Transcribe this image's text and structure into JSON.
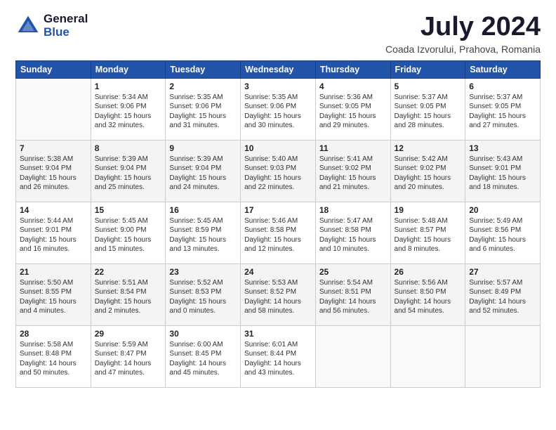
{
  "header": {
    "logo_general": "General",
    "logo_blue": "Blue",
    "title": "July 2024",
    "location": "Coada Izvorului, Prahova, Romania"
  },
  "weekdays": [
    "Sunday",
    "Monday",
    "Tuesday",
    "Wednesday",
    "Thursday",
    "Friday",
    "Saturday"
  ],
  "weeks": [
    [
      {
        "num": "",
        "info": ""
      },
      {
        "num": "1",
        "info": "Sunrise: 5:34 AM\nSunset: 9:06 PM\nDaylight: 15 hours\nand 32 minutes."
      },
      {
        "num": "2",
        "info": "Sunrise: 5:35 AM\nSunset: 9:06 PM\nDaylight: 15 hours\nand 31 minutes."
      },
      {
        "num": "3",
        "info": "Sunrise: 5:35 AM\nSunset: 9:06 PM\nDaylight: 15 hours\nand 30 minutes."
      },
      {
        "num": "4",
        "info": "Sunrise: 5:36 AM\nSunset: 9:05 PM\nDaylight: 15 hours\nand 29 minutes."
      },
      {
        "num": "5",
        "info": "Sunrise: 5:37 AM\nSunset: 9:05 PM\nDaylight: 15 hours\nand 28 minutes."
      },
      {
        "num": "6",
        "info": "Sunrise: 5:37 AM\nSunset: 9:05 PM\nDaylight: 15 hours\nand 27 minutes."
      }
    ],
    [
      {
        "num": "7",
        "info": "Sunrise: 5:38 AM\nSunset: 9:04 PM\nDaylight: 15 hours\nand 26 minutes."
      },
      {
        "num": "8",
        "info": "Sunrise: 5:39 AM\nSunset: 9:04 PM\nDaylight: 15 hours\nand 25 minutes."
      },
      {
        "num": "9",
        "info": "Sunrise: 5:39 AM\nSunset: 9:04 PM\nDaylight: 15 hours\nand 24 minutes."
      },
      {
        "num": "10",
        "info": "Sunrise: 5:40 AM\nSunset: 9:03 PM\nDaylight: 15 hours\nand 22 minutes."
      },
      {
        "num": "11",
        "info": "Sunrise: 5:41 AM\nSunset: 9:02 PM\nDaylight: 15 hours\nand 21 minutes."
      },
      {
        "num": "12",
        "info": "Sunrise: 5:42 AM\nSunset: 9:02 PM\nDaylight: 15 hours\nand 20 minutes."
      },
      {
        "num": "13",
        "info": "Sunrise: 5:43 AM\nSunset: 9:01 PM\nDaylight: 15 hours\nand 18 minutes."
      }
    ],
    [
      {
        "num": "14",
        "info": "Sunrise: 5:44 AM\nSunset: 9:01 PM\nDaylight: 15 hours\nand 16 minutes."
      },
      {
        "num": "15",
        "info": "Sunrise: 5:45 AM\nSunset: 9:00 PM\nDaylight: 15 hours\nand 15 minutes."
      },
      {
        "num": "16",
        "info": "Sunrise: 5:45 AM\nSunset: 8:59 PM\nDaylight: 15 hours\nand 13 minutes."
      },
      {
        "num": "17",
        "info": "Sunrise: 5:46 AM\nSunset: 8:58 PM\nDaylight: 15 hours\nand 12 minutes."
      },
      {
        "num": "18",
        "info": "Sunrise: 5:47 AM\nSunset: 8:58 PM\nDaylight: 15 hours\nand 10 minutes."
      },
      {
        "num": "19",
        "info": "Sunrise: 5:48 AM\nSunset: 8:57 PM\nDaylight: 15 hours\nand 8 minutes."
      },
      {
        "num": "20",
        "info": "Sunrise: 5:49 AM\nSunset: 8:56 PM\nDaylight: 15 hours\nand 6 minutes."
      }
    ],
    [
      {
        "num": "21",
        "info": "Sunrise: 5:50 AM\nSunset: 8:55 PM\nDaylight: 15 hours\nand 4 minutes."
      },
      {
        "num": "22",
        "info": "Sunrise: 5:51 AM\nSunset: 8:54 PM\nDaylight: 15 hours\nand 2 minutes."
      },
      {
        "num": "23",
        "info": "Sunrise: 5:52 AM\nSunset: 8:53 PM\nDaylight: 15 hours\nand 0 minutes."
      },
      {
        "num": "24",
        "info": "Sunrise: 5:53 AM\nSunset: 8:52 PM\nDaylight: 14 hours\nand 58 minutes."
      },
      {
        "num": "25",
        "info": "Sunrise: 5:54 AM\nSunset: 8:51 PM\nDaylight: 14 hours\nand 56 minutes."
      },
      {
        "num": "26",
        "info": "Sunrise: 5:56 AM\nSunset: 8:50 PM\nDaylight: 14 hours\nand 54 minutes."
      },
      {
        "num": "27",
        "info": "Sunrise: 5:57 AM\nSunset: 8:49 PM\nDaylight: 14 hours\nand 52 minutes."
      }
    ],
    [
      {
        "num": "28",
        "info": "Sunrise: 5:58 AM\nSunset: 8:48 PM\nDaylight: 14 hours\nand 50 minutes."
      },
      {
        "num": "29",
        "info": "Sunrise: 5:59 AM\nSunset: 8:47 PM\nDaylight: 14 hours\nand 47 minutes."
      },
      {
        "num": "30",
        "info": "Sunrise: 6:00 AM\nSunset: 8:45 PM\nDaylight: 14 hours\nand 45 minutes."
      },
      {
        "num": "31",
        "info": "Sunrise: 6:01 AM\nSunset: 8:44 PM\nDaylight: 14 hours\nand 43 minutes."
      },
      {
        "num": "",
        "info": ""
      },
      {
        "num": "",
        "info": ""
      },
      {
        "num": "",
        "info": ""
      }
    ]
  ]
}
